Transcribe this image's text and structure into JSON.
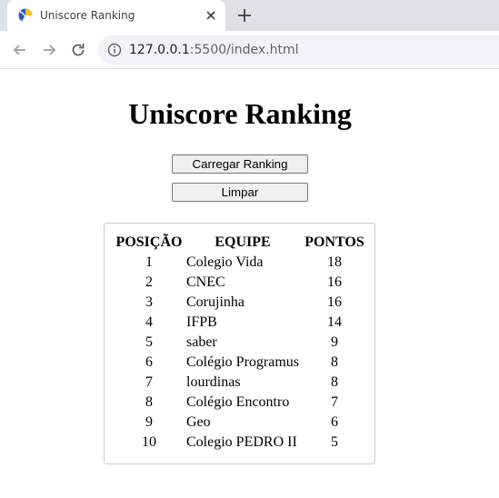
{
  "browser": {
    "tab_title": "Uniscore Ranking",
    "url_host": "127.0.0.1",
    "url_path": ":5500/index.html"
  },
  "page": {
    "title": "Uniscore Ranking",
    "load_button": "Carregar Ranking",
    "clear_button": "Limpar"
  },
  "table": {
    "headers": {
      "position": "POSIÇÃO",
      "team": "EQUIPE",
      "points": "PONTOS"
    },
    "rows": [
      {
        "position": "1",
        "team": "Colegio Vida",
        "points": "18"
      },
      {
        "position": "2",
        "team": "CNEC",
        "points": "16"
      },
      {
        "position": "3",
        "team": "Corujinha",
        "points": "16"
      },
      {
        "position": "4",
        "team": "IFPB",
        "points": "14"
      },
      {
        "position": "5",
        "team": "saber",
        "points": "9"
      },
      {
        "position": "6",
        "team": "Colégio Programus",
        "points": "8"
      },
      {
        "position": "7",
        "team": "lourdinas",
        "points": "8"
      },
      {
        "position": "8",
        "team": "Colégio Encontro",
        "points": "7"
      },
      {
        "position": "9",
        "team": "Geo",
        "points": "6"
      },
      {
        "position": "10",
        "team": "Colegio PEDRO II",
        "points": "5"
      }
    ]
  }
}
